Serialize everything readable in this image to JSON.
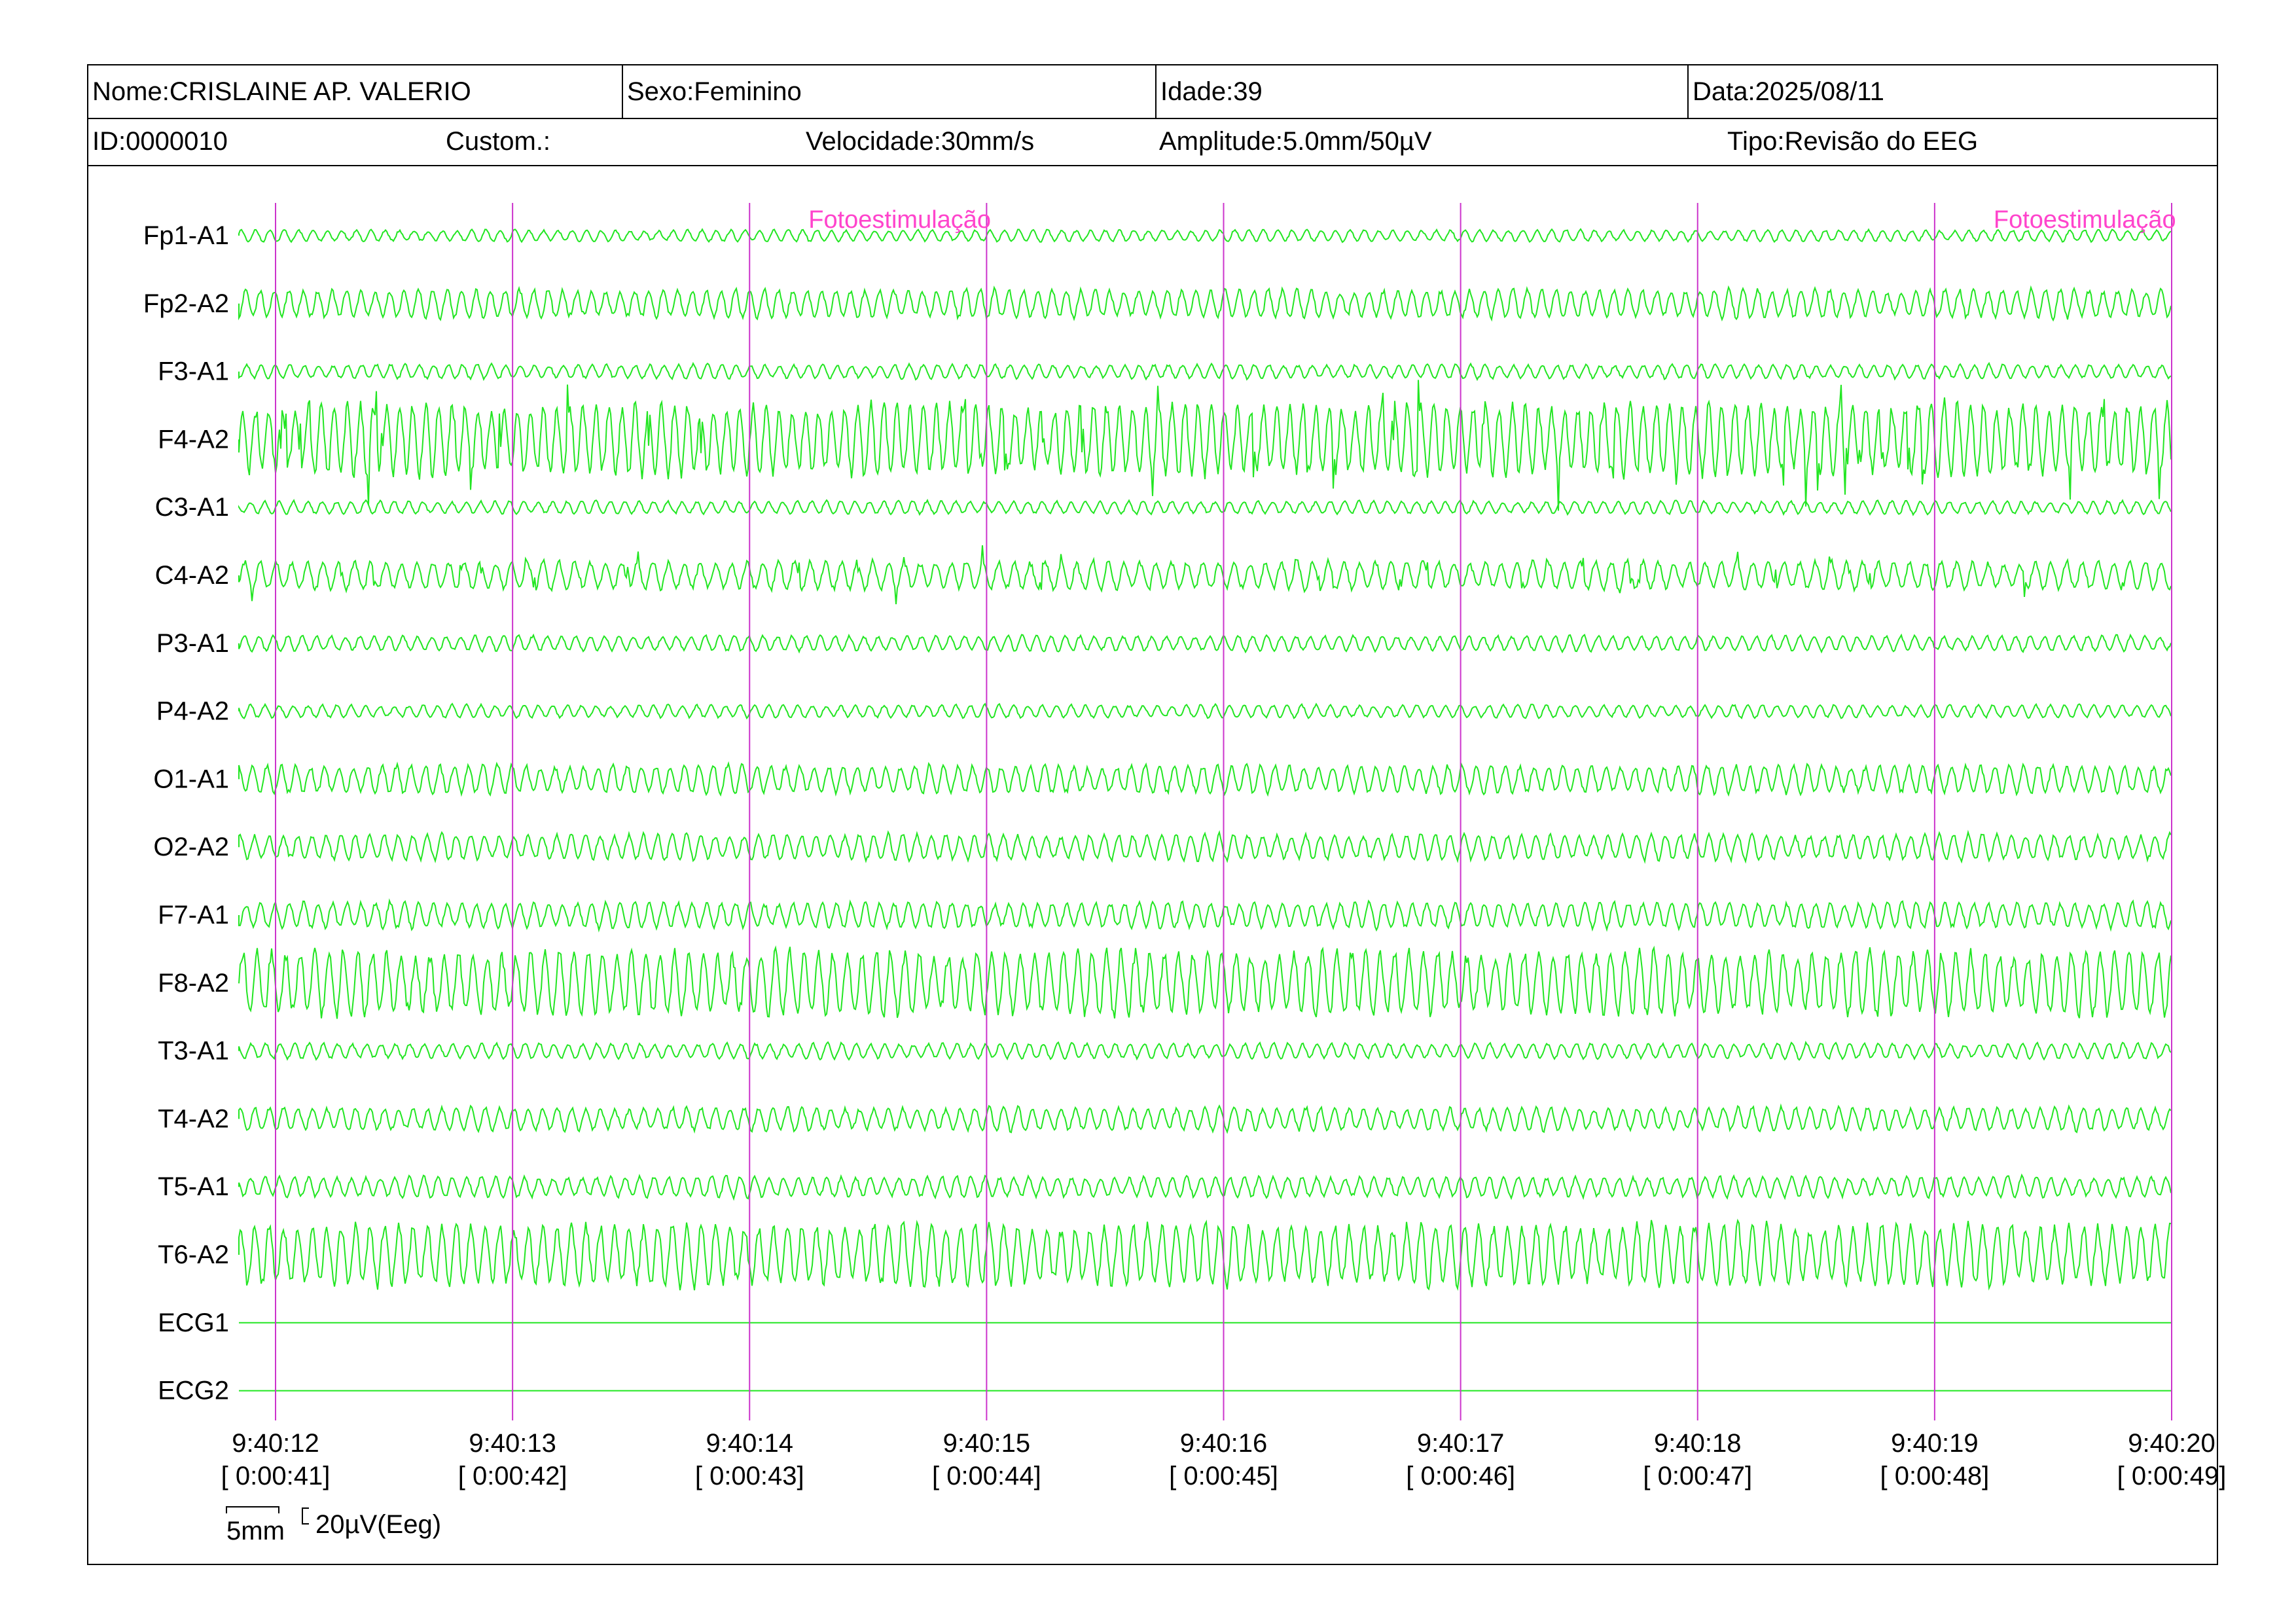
{
  "header": {
    "nome": "Nome:CRISLAINE AP. VALERIO",
    "sexo": "Sexo:Feminino",
    "idade": "Idade:39",
    "data": "Data:2025/08/11",
    "id": "ID:0000010",
    "custom": "Custom.:",
    "velocidade": "Velocidade:30mm/s",
    "amplitude": "Amplitude:5.0mm/50µV",
    "tipo": "Tipo:Revisão do EEG"
  },
  "chart_data": {
    "type": "line",
    "title": "",
    "channels": [
      "Fp1-A1",
      "Fp2-A2",
      "F3-A1",
      "F4-A2",
      "C3-A1",
      "C4-A2",
      "P3-A1",
      "P4-A2",
      "O1-A1",
      "O2-A2",
      "F7-A1",
      "F8-A2",
      "T3-A1",
      "T4-A2",
      "T5-A1",
      "T6-A2",
      "ECG1",
      "ECG2"
    ],
    "time_ticks": [
      {
        "clock": "9:40:12",
        "elapsed": "[ 0:00:41]"
      },
      {
        "clock": "9:40:13",
        "elapsed": "[ 0:00:42]"
      },
      {
        "clock": "9:40:14",
        "elapsed": "[ 0:00:43]"
      },
      {
        "clock": "9:40:15",
        "elapsed": "[ 0:00:44]"
      },
      {
        "clock": "9:40:16",
        "elapsed": "[ 0:00:45]"
      },
      {
        "clock": "9:40:17",
        "elapsed": "[ 0:00:46]"
      },
      {
        "clock": "9:40:18",
        "elapsed": "[ 0:00:47]"
      },
      {
        "clock": "9:40:19",
        "elapsed": "[ 0:00:48]"
      },
      {
        "clock": "9:40:20",
        "elapsed": "[ 0:00:49]"
      }
    ],
    "annotations": [
      {
        "label": "Fotoestimulação",
        "time": "9:40:14"
      },
      {
        "label": "Fotoestimulação",
        "time": "9:40:19"
      }
    ],
    "scale": {
      "time": "5mm",
      "amplitude": "20µV(Eeg)"
    },
    "colors": {
      "trace": "#22e622",
      "marker": "#cc33cc",
      "annotation": "#ff44cc"
    }
  }
}
